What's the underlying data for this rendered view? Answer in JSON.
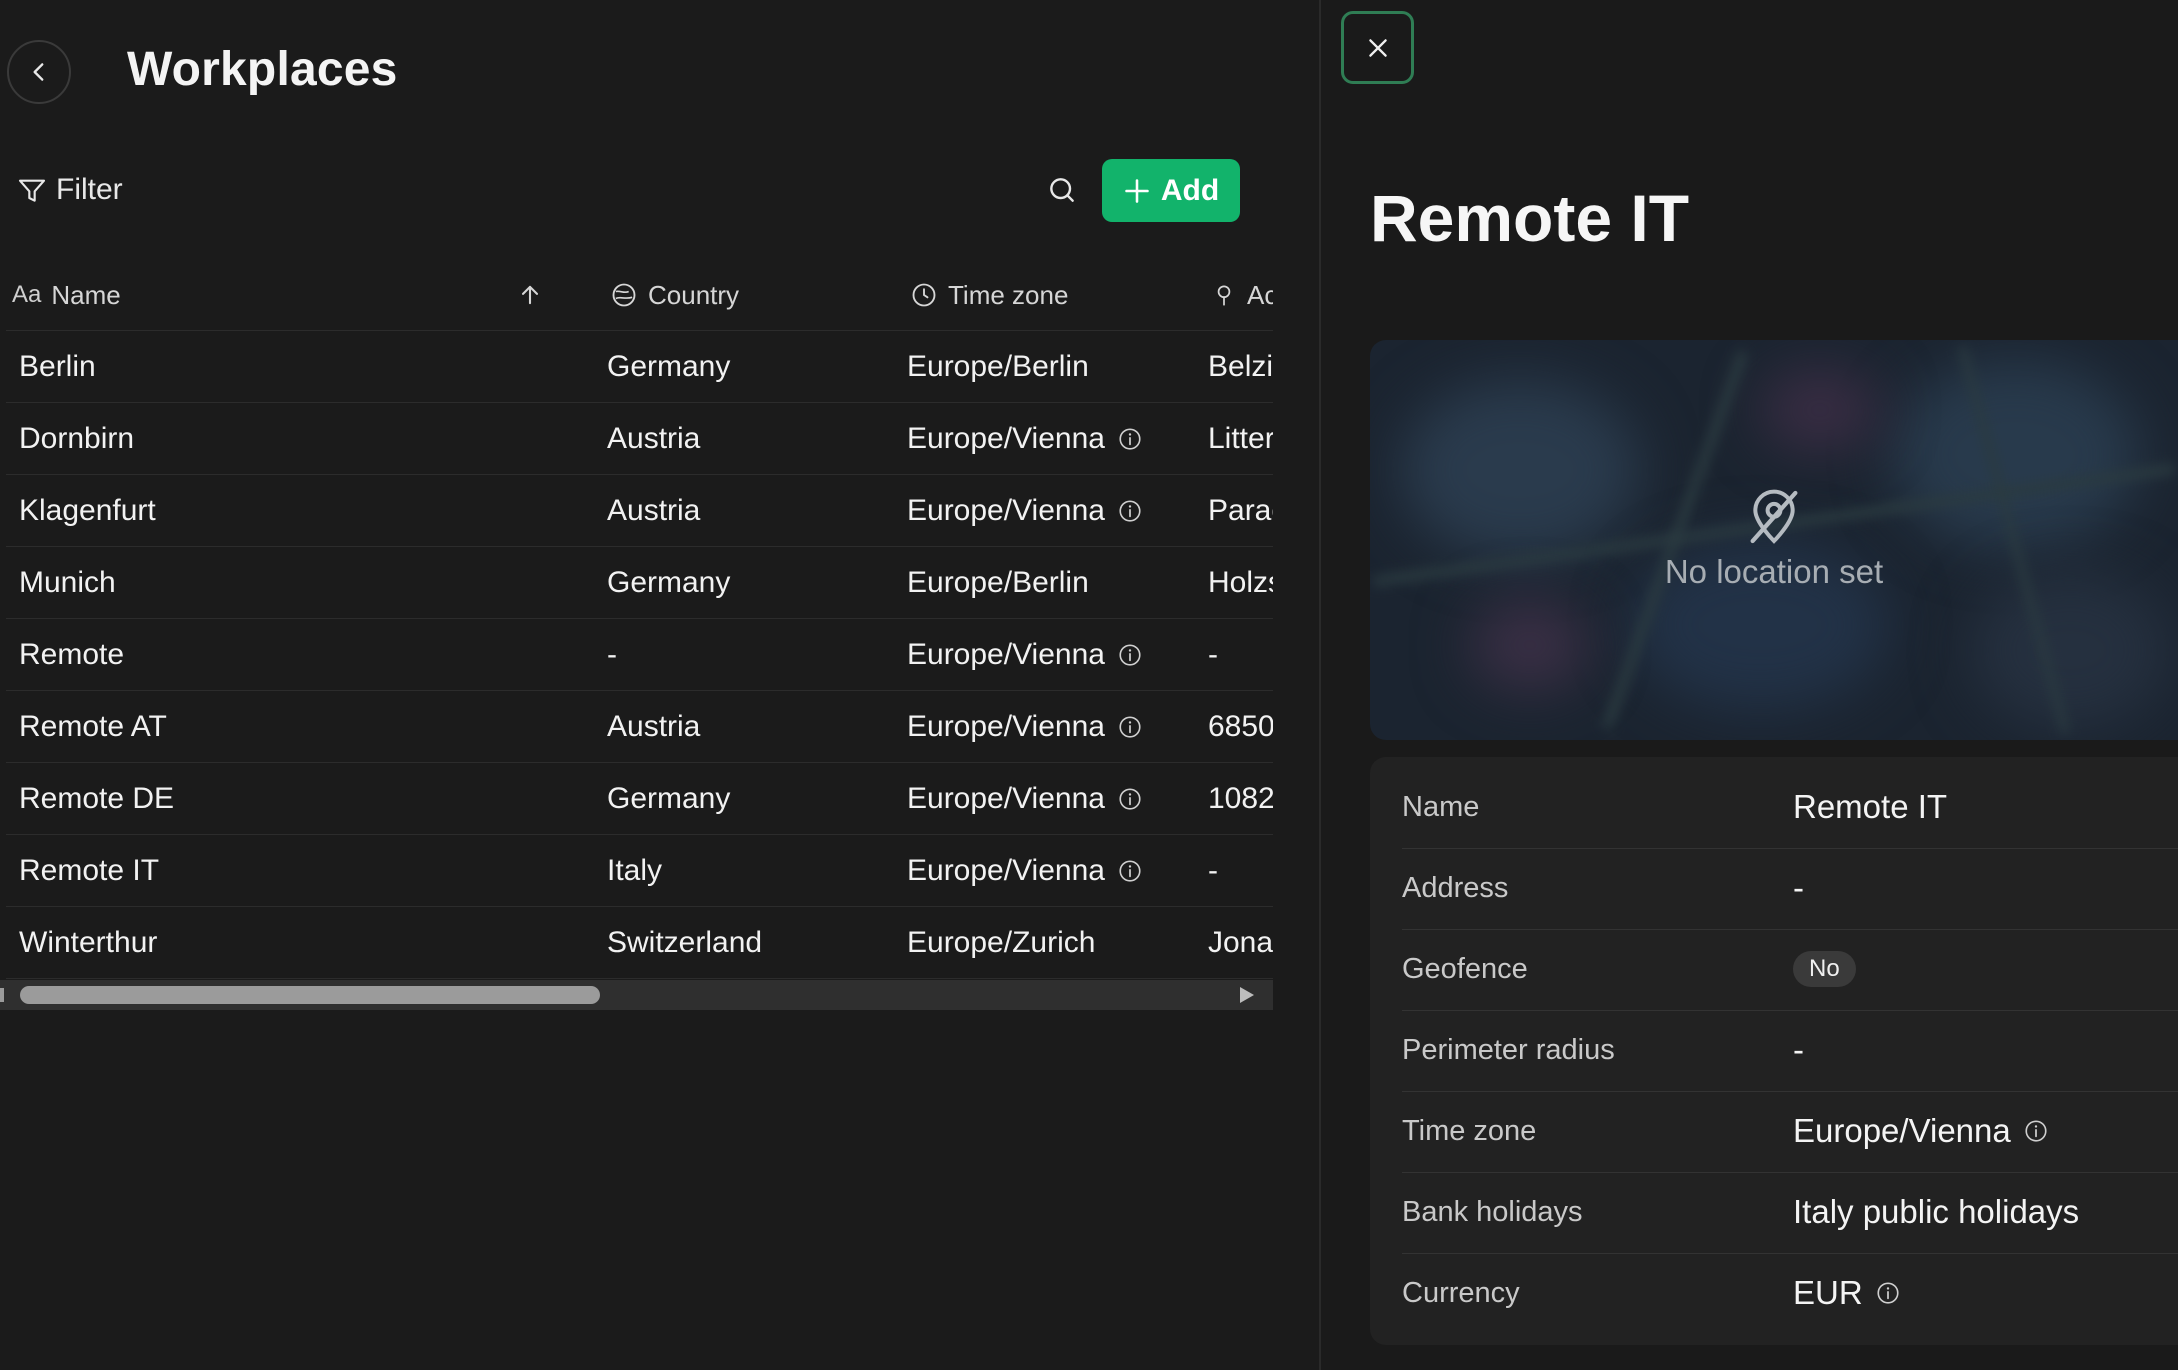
{
  "header": {
    "title": "Workplaces"
  },
  "toolbar": {
    "filter_label": "Filter",
    "add_label": "Add"
  },
  "table": {
    "columns": [
      {
        "icon": "text-type-icon",
        "prefix": "Aa",
        "label": "Name"
      },
      {
        "icon": "globe-icon",
        "label": "Country"
      },
      {
        "icon": "clock-icon",
        "label": "Time zone"
      },
      {
        "icon": "pin-icon",
        "label": "Ac"
      }
    ],
    "sort": {
      "column": "Name",
      "direction": "ascending"
    },
    "rows": [
      {
        "name": "Berlin",
        "country": "Germany",
        "timezone": "Europe/Berlin",
        "tz_info": false,
        "address": "Belzi"
      },
      {
        "name": "Dornbirn",
        "country": "Austria",
        "timezone": "Europe/Vienna",
        "tz_info": true,
        "address": "Litter"
      },
      {
        "name": "Klagenfurt",
        "country": "Austria",
        "timezone": "Europe/Vienna",
        "tz_info": true,
        "address": "Parac"
      },
      {
        "name": "Munich",
        "country": "Germany",
        "timezone": "Europe/Berlin",
        "tz_info": false,
        "address": "Holzs"
      },
      {
        "name": "Remote",
        "country": "-",
        "timezone": "Europe/Vienna",
        "tz_info": true,
        "address": "-"
      },
      {
        "name": "Remote AT",
        "country": "Austria",
        "timezone": "Europe/Vienna",
        "tz_info": true,
        "address": "6850"
      },
      {
        "name": "Remote DE",
        "country": "Germany",
        "timezone": "Europe/Vienna",
        "tz_info": true,
        "address": "1082"
      },
      {
        "name": "Remote IT",
        "country": "Italy",
        "timezone": "Europe/Vienna",
        "tz_info": true,
        "address": "-"
      },
      {
        "name": "Winterthur",
        "country": "Switzerland",
        "timezone": "Europe/Zurich",
        "tz_info": false,
        "address": "Jona"
      }
    ]
  },
  "detail": {
    "title": "Remote IT",
    "map_message": "No location set",
    "properties": [
      {
        "label": "Name",
        "value": "Remote IT",
        "type": "text"
      },
      {
        "label": "Address",
        "value": "-",
        "type": "text"
      },
      {
        "label": "Geofence",
        "value": "No",
        "type": "badge"
      },
      {
        "label": "Perimeter radius",
        "value": "-",
        "type": "text"
      },
      {
        "label": "Time zone",
        "value": "Europe/Vienna",
        "type": "text",
        "info": true
      },
      {
        "label": "Bank holidays",
        "value": "Italy public holidays",
        "type": "text"
      },
      {
        "label": "Currency",
        "value": "EUR",
        "type": "text",
        "info": true
      }
    ]
  },
  "colors": {
    "accent": "#12b36b",
    "background": "#1b1b1b",
    "close_border": "#2f7d54"
  }
}
